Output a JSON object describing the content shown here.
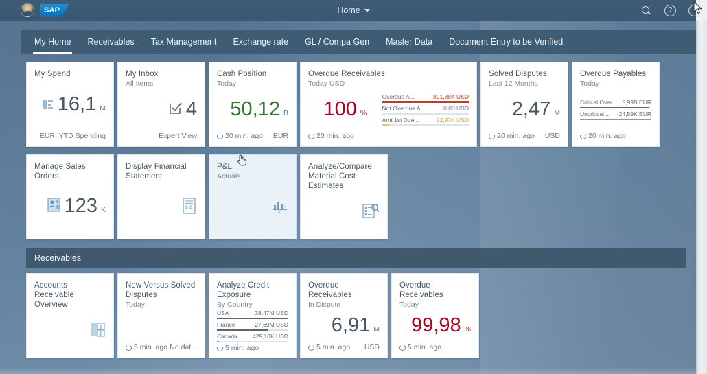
{
  "shell": {
    "title": "Home",
    "avatar_name": "user-avatar",
    "logo_text": "SAP",
    "icons": {
      "search": "search-icon",
      "help": "?",
      "user": "user-settings-icon"
    }
  },
  "nav": {
    "tabs": [
      {
        "label": "My Home",
        "active": true
      },
      {
        "label": "Receivables",
        "active": false
      },
      {
        "label": "Tax Management",
        "active": false
      },
      {
        "label": "Exchange rate",
        "active": false
      },
      {
        "label": "GL / Compa Gen",
        "active": false
      },
      {
        "label": "Master Data",
        "active": false
      },
      {
        "label": "Document Entry to be Verified",
        "active": false
      }
    ]
  },
  "sections": [
    {
      "name": "my-home-group",
      "header": null,
      "rows": [
        {
          "tiles": [
            {
              "name": "my-spend",
              "title": "My Spend",
              "subtitle": "",
              "kpi": {
                "value": "16,1",
                "unit": "M",
                "color": "default"
              },
              "icon": "bar-chart-icon",
              "footer_left": "",
              "footer_right": "EUR, YTD Spending"
            },
            {
              "name": "my-inbox",
              "title": "My Inbox",
              "subtitle": "All Items",
              "kpi": {
                "value": "4",
                "unit": "",
                "color": "default"
              },
              "icon": "task-check-icon",
              "footer_left": "",
              "footer_right": "Expert View"
            },
            {
              "name": "cash-position",
              "title": "Cash Position",
              "subtitle": "Today",
              "kpi": {
                "value": "50,12",
                "unit": "B",
                "color": "green"
              },
              "footer_left": "20 min. ago",
              "footer_right": "EUR"
            },
            {
              "name": "overdue-receivables-today",
              "title": "Overdue Receivables",
              "subtitle": "Today USD",
              "kpi": {
                "value": "100",
                "unit": "%",
                "color": "red"
              },
              "bars": [
                {
                  "name": "Overdue A...",
                  "value": "891,88K USD",
                  "pct": 100,
                  "color": "red"
                },
                {
                  "name": "Not Overdue A...",
                  "value": "0.00 USD",
                  "pct": 0,
                  "color": "gray"
                },
                {
                  "name": "Amt 1st Due...",
                  "value": "22,97K USD",
                  "pct": 8,
                  "color": "orange"
                }
              ],
              "footer_left": "20 min. ago",
              "footer_right": ""
            },
            {
              "name": "solved-disputes",
              "title": "Solved Disputes",
              "subtitle": "Last 12 Months",
              "kpi": {
                "value": "2,47",
                "unit": "M",
                "color": "default"
              },
              "footer_left": "20 min. ago",
              "footer_right": "USD"
            },
            {
              "name": "overdue-payables",
              "title": "Overdue Payables",
              "subtitle": "Today",
              "bars": [
                {
                  "name": "Critical Over...",
                  "value": "8,99B EUR",
                  "pct": 96,
                  "color": "dark"
                },
                {
                  "name": "Uncritical ...",
                  "value": "-24,59K EUR",
                  "pct": 100,
                  "color": "slate"
                }
              ],
              "footer_left": "20 min. ago",
              "footer_right": ""
            }
          ]
        },
        {
          "tiles": [
            {
              "name": "manage-sales-orders",
              "title": "Manage Sales Orders",
              "subtitle": "",
              "kpi": {
                "value": "123",
                "unit": "K",
                "color": "default"
              },
              "icon": "sales-order-icon",
              "footer_left": "",
              "footer_right": ""
            },
            {
              "name": "display-financial-statement",
              "title": "Display Financial Statement",
              "subtitle": "",
              "icon": "financial-statement-icon",
              "footer_left": "",
              "footer_right": ""
            },
            {
              "name": "pl-actuals",
              "title": "P&L",
              "subtitle": "Actuals",
              "icon": "column-chart-icon",
              "hovered": true,
              "footer_left": "",
              "footer_right": ""
            },
            {
              "name": "analyze-compare-material-cost-estimates",
              "title": "Analyze/Compare Material Cost Estimates",
              "subtitle": "",
              "icon": "analyze-list-icon",
              "footer_left": "",
              "footer_right": ""
            }
          ]
        }
      ]
    },
    {
      "name": "receivables-group",
      "header": "Receivables",
      "rows": [
        {
          "tiles": [
            {
              "name": "accounts-receivable-overview",
              "title": "Accounts Receivable Overview",
              "subtitle": "",
              "icon": "receivable-overview-icon",
              "footer_left": "",
              "footer_right": ""
            },
            {
              "name": "new-versus-solved-disputes",
              "title": "New Versus Solved Disputes",
              "subtitle": "Today",
              "footer_left": "5 min. ago",
              "footer_right": "No dat..."
            },
            {
              "name": "analyze-credit-exposure",
              "title": "Analyze Credit Exposure",
              "subtitle": "By Country",
              "bars": [
                {
                  "name": "USA",
                  "value": "38,47M USD",
                  "pct": 100,
                  "color": "dark"
                },
                {
                  "name": "France",
                  "value": "27,69M USD",
                  "pct": 72,
                  "color": "dark"
                },
                {
                  "name": "Canada",
                  "value": "429,10K USD",
                  "pct": 3,
                  "color": "slate"
                }
              ],
              "footer_left": "5 min. ago",
              "footer_right": ""
            },
            {
              "name": "overdue-receivables-in-dispute",
              "title": "Overdue Receivables",
              "subtitle": "In Dispute",
              "kpi": {
                "value": "6,91",
                "unit": "M",
                "color": "default"
              },
              "footer_left": "5 min. ago",
              "footer_right": "USD"
            },
            {
              "name": "overdue-receivables-today-2",
              "title": "Overdue Receivables",
              "subtitle": "Today",
              "kpi": {
                "value": "99,98",
                "unit": "%",
                "color": "red"
              },
              "footer_left": "5 min. ago",
              "footer_right": ""
            }
          ]
        }
      ]
    }
  ],
  "colors": {
    "shell_bg": "#3e5c76",
    "nav_bg": "#3f5c75",
    "section_header_bg": "#41596e",
    "accent_green": "#2b7d2b",
    "accent_red": "#b00020",
    "tile_bg": "#ffffff",
    "tile_hover_bg": "#eaf2f7"
  }
}
